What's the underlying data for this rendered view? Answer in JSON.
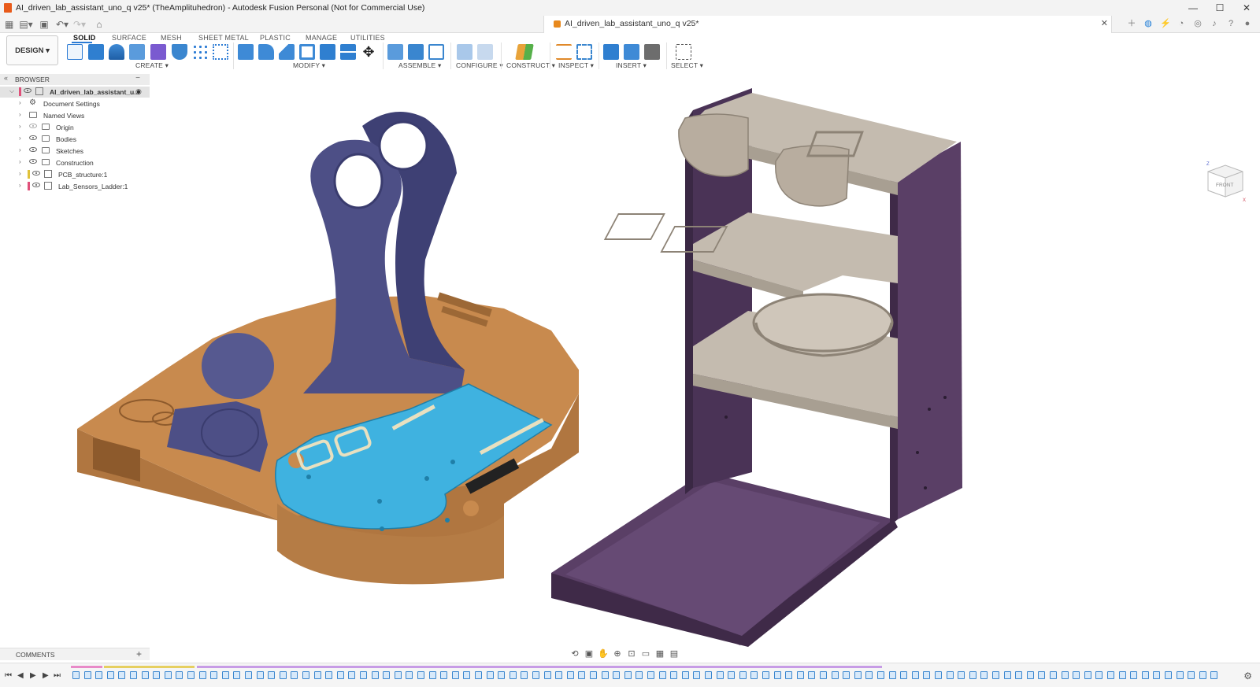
{
  "window": {
    "title": "AI_driven_lab_assistant_uno_q v25* (TheAmplituhedron) - Autodesk Fusion Personal (Not for Commercial Use)",
    "controls": [
      "—",
      "☐",
      "✕"
    ]
  },
  "document_tab": {
    "title": "AI_driven_lab_assistant_uno_q v25*",
    "close": "✕"
  },
  "workspace": {
    "label": "DESIGN ▾"
  },
  "ribbon": {
    "tabs": [
      "SOLID",
      "SURFACE",
      "MESH",
      "SHEET METAL",
      "PLASTIC",
      "MANAGE",
      "UTILITIES"
    ],
    "active_tab": "SOLID",
    "groups": [
      "CREATE ▾",
      "MODIFY ▾",
      "ASSEMBLE ▾",
      "CONFIGURE ▾",
      "CONSTRUCT ▾",
      "INSPECT ▾",
      "INSERT ▾",
      "SELECT ▾"
    ]
  },
  "browser": {
    "header": "BROWSER",
    "items": [
      {
        "label": "AI_driven_lab_assistant_u...",
        "kind": "root",
        "icon": "component-icon"
      },
      {
        "label": "Document Settings",
        "kind": "settings",
        "icon": "gear-icon"
      },
      {
        "label": "Named Views",
        "kind": "folder",
        "icon": "folder-icon"
      },
      {
        "label": "Origin",
        "kind": "folder",
        "icon": "folder-icon"
      },
      {
        "label": "Bodies",
        "kind": "folder",
        "icon": "folder-icon"
      },
      {
        "label": "Sketches",
        "kind": "folder",
        "icon": "folder-icon"
      },
      {
        "label": "Construction",
        "kind": "folder",
        "icon": "folder-icon"
      },
      {
        "label": "PCB_structure:1",
        "kind": "component",
        "icon": "component-icon",
        "tag_color": "#e0c23a"
      },
      {
        "label": "Lab_Sensors_Ladder:1",
        "kind": "component",
        "icon": "component-icon",
        "tag_color": "#e0507a"
      }
    ]
  },
  "viewcube": {
    "face": "FRONT",
    "axes": [
      "Z",
      "X"
    ]
  },
  "comments": {
    "label": "COMMENTS",
    "add": "+"
  },
  "colors": {
    "accent": "#2b7bd4",
    "base_body": "#c88a4e",
    "stand_body": "#4d4f86",
    "pcb_body": "#3fb2e0",
    "frame_body": "#5a3f66",
    "shelf_body": "#bfb5a8"
  }
}
